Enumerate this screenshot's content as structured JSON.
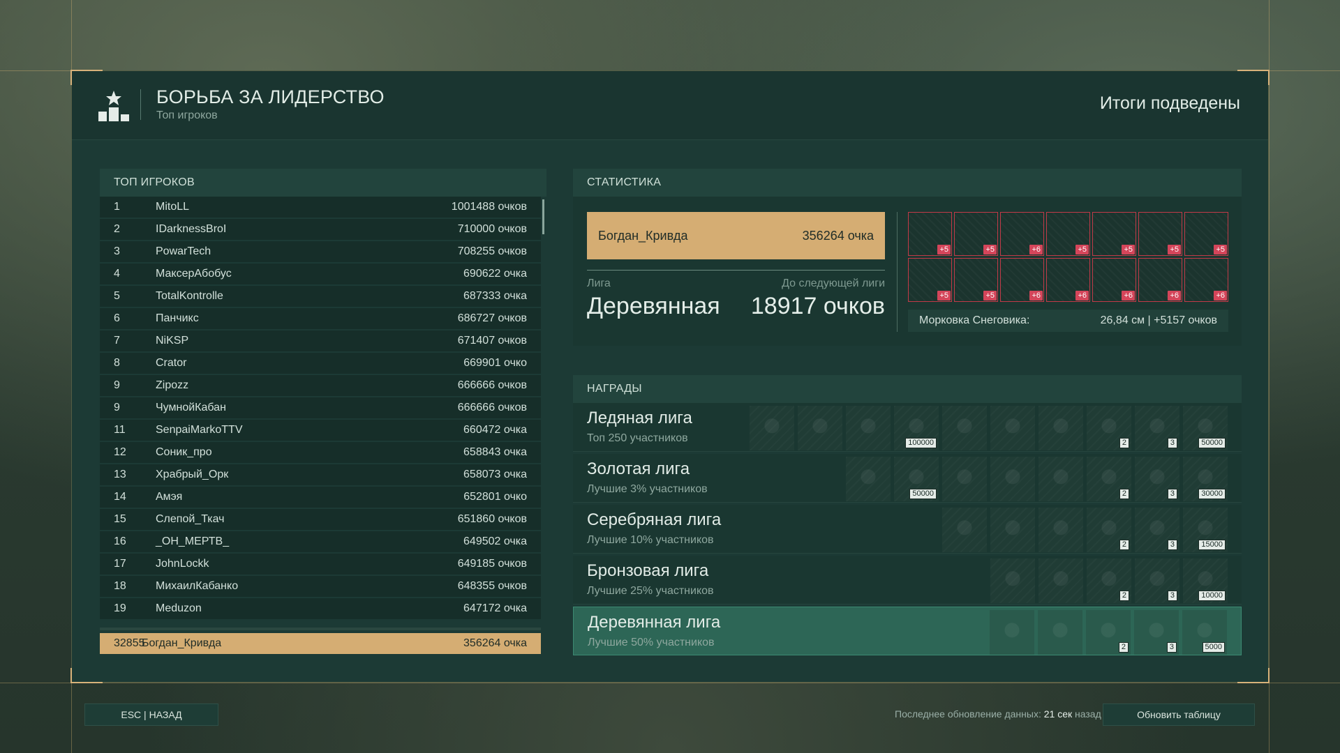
{
  "header": {
    "title": "БОРЬБА ЗА ЛИДЕРСТВО",
    "subtitle": "Топ игроков",
    "status": "Итоги подведены",
    "icon": "trophy-podium-icon"
  },
  "leaderboard": {
    "heading": "ТОП ИГРОКОВ",
    "rows": [
      {
        "rank": "1",
        "name": "MitoLL",
        "points": "1001488 очков"
      },
      {
        "rank": "2",
        "name": "IDarknessBroI",
        "points": "710000 очков"
      },
      {
        "rank": "3",
        "name": "PowarTech",
        "points": "708255 очков"
      },
      {
        "rank": "4",
        "name": "МаксерАбобус",
        "points": "690622 очка"
      },
      {
        "rank": "5",
        "name": "TotalKontrolle",
        "points": "687333 очка"
      },
      {
        "rank": "6",
        "name": "Панчикс",
        "points": "686727 очков"
      },
      {
        "rank": "7",
        "name": "NiKSP",
        "points": "671407 очков"
      },
      {
        "rank": "8",
        "name": "Crator",
        "points": "669901 очко"
      },
      {
        "rank": "9",
        "name": "Zipozz",
        "points": "666666 очков"
      },
      {
        "rank": "9",
        "name": "ЧумнойКабан",
        "points": "666666 очков"
      },
      {
        "rank": "11",
        "name": "SenpaiMarkoTTV",
        "points": "660472 очка"
      },
      {
        "rank": "12",
        "name": "Соник_про",
        "points": "658843 очка"
      },
      {
        "rank": "13",
        "name": "Храбрый_Орк",
        "points": "658073 очка"
      },
      {
        "rank": "14",
        "name": "Амэя",
        "points": "652801 очко"
      },
      {
        "rank": "15",
        "name": "Слепой_Ткач",
        "points": "651860 очков"
      },
      {
        "rank": "16",
        "name": "_ОН_МЕРТВ_",
        "points": "649502 очка"
      },
      {
        "rank": "17",
        "name": "JohnLockk",
        "points": "649185 очков"
      },
      {
        "rank": "18",
        "name": "МихаилКабанко",
        "points": "648355 очков"
      },
      {
        "rank": "19",
        "name": "Meduzon",
        "points": "647172 очка"
      }
    ],
    "me": {
      "rank": "32855",
      "name": "Богдан_Кривда",
      "points": "356264 очка"
    }
  },
  "stats": {
    "heading": "СТАТИСТИКА",
    "player_name": "Богдан_Кривда",
    "player_points": "356264 очка",
    "league_label": "Лига",
    "league_value": "Деревянная",
    "next_label": "До следующей лиги",
    "next_value": "18917 очков",
    "items": [
      {
        "bonus": "+5"
      },
      {
        "bonus": "+5"
      },
      {
        "bonus": "+6"
      },
      {
        "bonus": "+5"
      },
      {
        "bonus": "+5"
      },
      {
        "bonus": "+5"
      },
      {
        "bonus": "+5"
      },
      {
        "bonus": "+5"
      },
      {
        "bonus": "+5"
      },
      {
        "bonus": "+6"
      },
      {
        "bonus": "+6"
      },
      {
        "bonus": "+6"
      },
      {
        "bonus": "+6"
      },
      {
        "bonus": "+6"
      }
    ],
    "carrot_label": "Морковка Снеговика:",
    "carrot_value": "26,84 см | +5157 очков"
  },
  "rewards": {
    "heading": "НАГРАДЫ",
    "leagues": [
      {
        "name": "Ледяная лига",
        "desc": "Топ 250 участников",
        "active": false,
        "items": [
          "",
          "",
          "",
          "100000",
          "",
          "",
          "",
          "2",
          "3",
          "50000"
        ]
      },
      {
        "name": "Золотая лига",
        "desc": "Лучшие 3% участников",
        "active": false,
        "items": [
          "",
          "50000",
          "",
          "",
          "",
          "2",
          "3",
          "30000"
        ]
      },
      {
        "name": "Серебряная лига",
        "desc": "Лучшие 10% участников",
        "active": false,
        "items": [
          "",
          "",
          "",
          "2",
          "3",
          "15000"
        ]
      },
      {
        "name": "Бронзовая лига",
        "desc": "Лучшие 25% участников",
        "active": false,
        "items": [
          "",
          "",
          "2",
          "3",
          "10000"
        ]
      },
      {
        "name": "Деревянная лига",
        "desc": "Лучшие 50% участников",
        "active": true,
        "items": [
          "",
          "",
          "2",
          "3",
          "5000"
        ]
      }
    ]
  },
  "footer": {
    "back_label": "ESC | НАЗАД",
    "update_prefix": "Последнее обновление данных:",
    "update_value": "21 сек",
    "update_suffix": "назад",
    "refresh_label": "Обновить таблицу"
  },
  "colors": {
    "accent": "#d5ad73",
    "panel": "#1c3a35",
    "bonus": "#d4455a"
  }
}
